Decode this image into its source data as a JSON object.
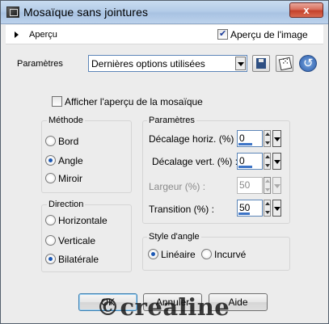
{
  "window": {
    "title": "Mosaïque sans jointures",
    "close_label": "x"
  },
  "preview": {
    "toggle_label": "Aperçu",
    "image_preview_label": "Aperçu de l'image",
    "image_preview_checked": true
  },
  "presets": {
    "label": "Paramètres",
    "selected": "Dernières options utilisées",
    "save_icon": "save-icon",
    "random_icon": "dice-icon",
    "reset_icon": "reset-icon"
  },
  "mosaic_preview": {
    "label": "Afficher l'aperçu de la mosaïque",
    "checked": false
  },
  "method": {
    "title": "Méthode",
    "options": [
      "Bord",
      "Angle",
      "Miroir"
    ],
    "selected": "Angle"
  },
  "direction": {
    "title": "Direction",
    "options": [
      "Horizontale",
      "Verticale",
      "Bilatérale"
    ],
    "selected": "Bilatérale"
  },
  "parameters": {
    "title": "Paramètres",
    "fields": [
      {
        "label": "Décalage horiz. (%) :",
        "value": "0",
        "level": 0.6,
        "enabled": true
      },
      {
        "label": "Décalage vert. (%) :",
        "value": "0",
        "level": 0.6,
        "enabled": true
      },
      {
        "label": "Largeur (%) :",
        "value": "50",
        "level": 0,
        "enabled": false
      },
      {
        "label": "Transition (%) :",
        "value": "50",
        "level": 0.5,
        "enabled": true
      }
    ]
  },
  "corner_style": {
    "title": "Style d'angle",
    "options": [
      "Linéaire",
      "Incurvé"
    ],
    "selected": "Linéaire"
  },
  "buttons": {
    "ok": "OK",
    "cancel": "Annuler",
    "help": "Aide"
  },
  "watermark": "©crealine",
  "colors": {
    "accent": "#3d74c6",
    "close": "#c4412b"
  }
}
